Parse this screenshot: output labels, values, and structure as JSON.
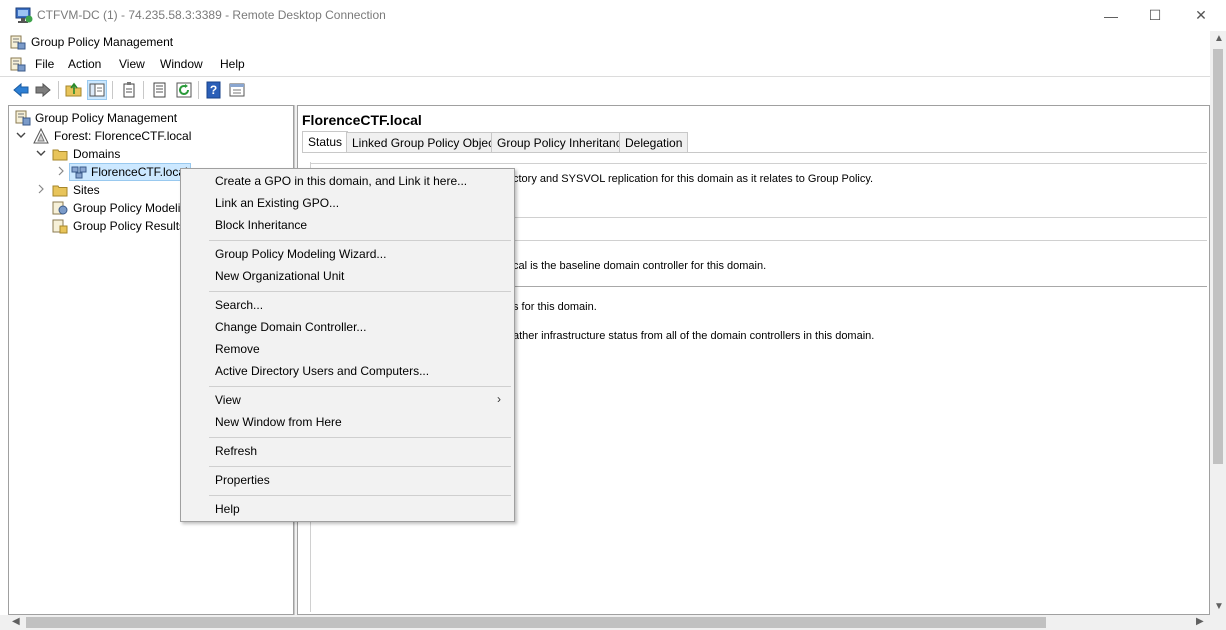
{
  "window": {
    "title": "CTFVM-DC (1) - 74.235.58.3:3389 - Remote Desktop Connection",
    "minimize": "—",
    "maximize": "☐",
    "close": "✕"
  },
  "app": {
    "title": "Group Policy Management"
  },
  "menubar": {
    "items": [
      "File",
      "Action",
      "View",
      "Window",
      "Help"
    ]
  },
  "toolbar": {
    "icons": [
      "back-arrow-icon",
      "forward-arrow-icon",
      "folder-up-icon",
      "show-hide-tree-icon",
      "clipboard-icon",
      "properties-icon",
      "refresh-icon",
      "help-icon",
      "console-icon"
    ]
  },
  "tree": {
    "root": "Group Policy Management",
    "forest": "Forest: FlorenceCTF.local",
    "domains": "Domains",
    "domain": "FlorenceCTF.local",
    "sites": "Sites",
    "modeling": "Group Policy Modeli",
    "results": "Group Policy Results"
  },
  "right": {
    "title": "FlorenceCTF.local",
    "tabs": [
      "Status",
      "Linked Group Policy Objects",
      "Group Policy Inheritance",
      "Delegation"
    ],
    "lines": [
      "ctory and SYSVOL replication for this domain as it relates to Group Policy.",
      "cal is the baseline domain controller for this domain.",
      "s for this domain.",
      "ather infrastructure status from all of the domain controllers in this domain."
    ]
  },
  "context_menu": {
    "items": [
      "Create a GPO in this domain, and Link it here...",
      "Link an Existing GPO...",
      "Block Inheritance",
      "Group Policy Modeling Wizard...",
      "New Organizational Unit",
      "Search...",
      "Change Domain Controller...",
      "Remove",
      "Active Directory Users and Computers...",
      "View",
      "New Window from Here",
      "Refresh",
      "Properties",
      "Help"
    ],
    "submenu_arrow": "›"
  },
  "colors": {
    "selection": "#cce8ff",
    "menu_bg": "#f2f2f2",
    "border": "#a0a0a0"
  }
}
